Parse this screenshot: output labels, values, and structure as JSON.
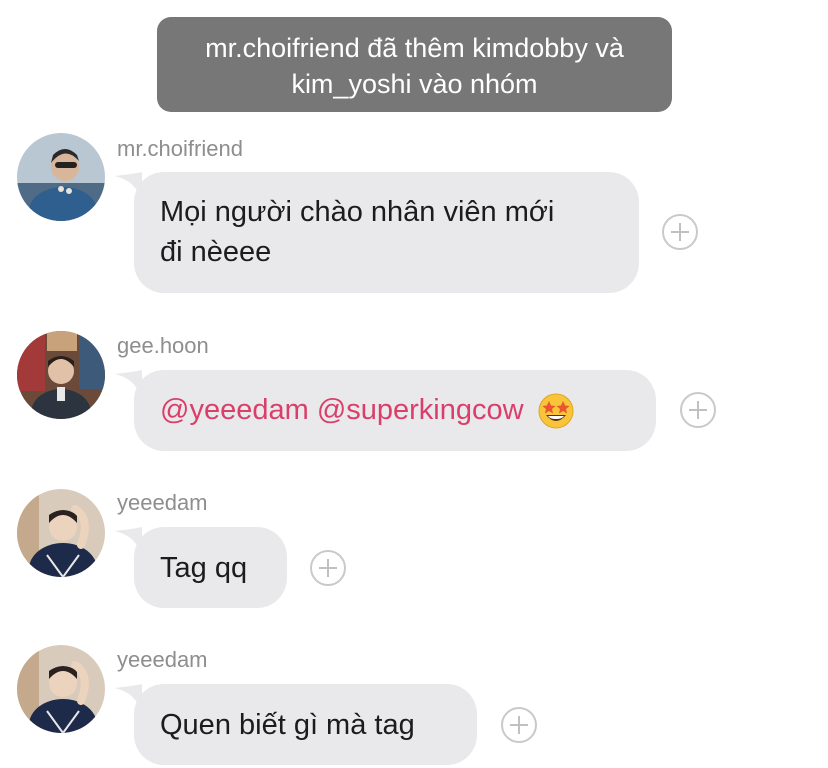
{
  "system_notice": {
    "line1": "mr.choifriend đã thêm kimdobby và",
    "line2": "kim_yoshi vào nhóm"
  },
  "messages": [
    {
      "username": "mr.choifriend",
      "lines": [
        "Mọi người chào nhân viên mới",
        "đi nèeee"
      ]
    },
    {
      "username": "gee.hoon",
      "mention1": "@yeeedam",
      "mention2": "@superkingcow",
      "emoji": "star-struck-emoji"
    },
    {
      "username": "yeeedam",
      "text": "Tag qq"
    },
    {
      "username": "yeeedam",
      "text": "Quen biết gì mà tag"
    }
  ],
  "colors": {
    "notice_bg": "#777777",
    "bubble_bg": "#e9e9eb",
    "mention": "#d93f6a",
    "username": "#8e8e8e"
  }
}
